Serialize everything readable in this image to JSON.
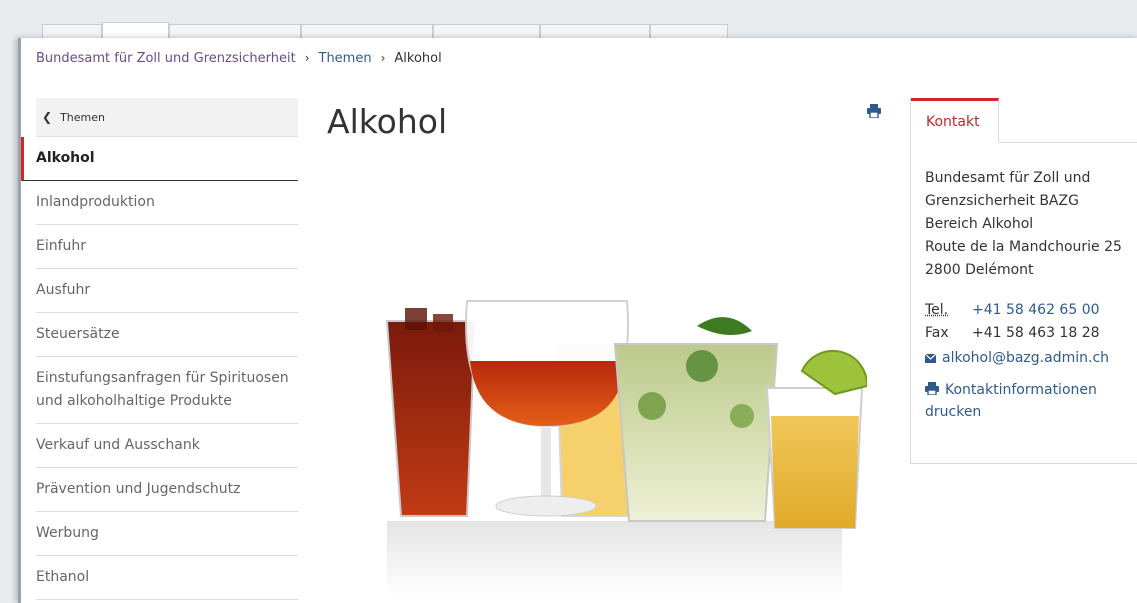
{
  "breadcrumb": {
    "root": "Bundesamt für Zoll und Grenzsicherheit",
    "parent": "Themen",
    "current": "Alkohol",
    "separator": "›"
  },
  "sidebar": {
    "back_label": "Themen",
    "items": [
      {
        "label": "Alkohol"
      },
      {
        "label": "Inlandproduktion"
      },
      {
        "label": "Einfuhr"
      },
      {
        "label": "Ausfuhr"
      },
      {
        "label": "Steuersätze"
      },
      {
        "label": "Einstufungsanfragen für Spirituosen und alkoholhaltige Produkte"
      },
      {
        "label": "Verkauf und Ausschank"
      },
      {
        "label": "Prävention und Jugendschutz"
      },
      {
        "label": "Werbung"
      },
      {
        "label": "Ethanol"
      }
    ]
  },
  "main": {
    "title": "Alkohol"
  },
  "contact": {
    "tab_label": "Kontakt",
    "address": [
      "Bundesamt für Zoll und",
      "Grenzsicherheit BAZG",
      "Bereich Alkohol",
      "Route de la Mandchourie 25",
      "2800 Delémont"
    ],
    "tel_label": "Tel.",
    "tel": "+41 58 462 65 00",
    "fax_label": "Fax",
    "fax": "+41 58 463 18 28",
    "email": "alkohol@bazg.admin.ch",
    "print_label": "Kontaktinformationen drucken"
  },
  "colors": {
    "accent": "#d8232a",
    "link": "#2f5a8f"
  }
}
